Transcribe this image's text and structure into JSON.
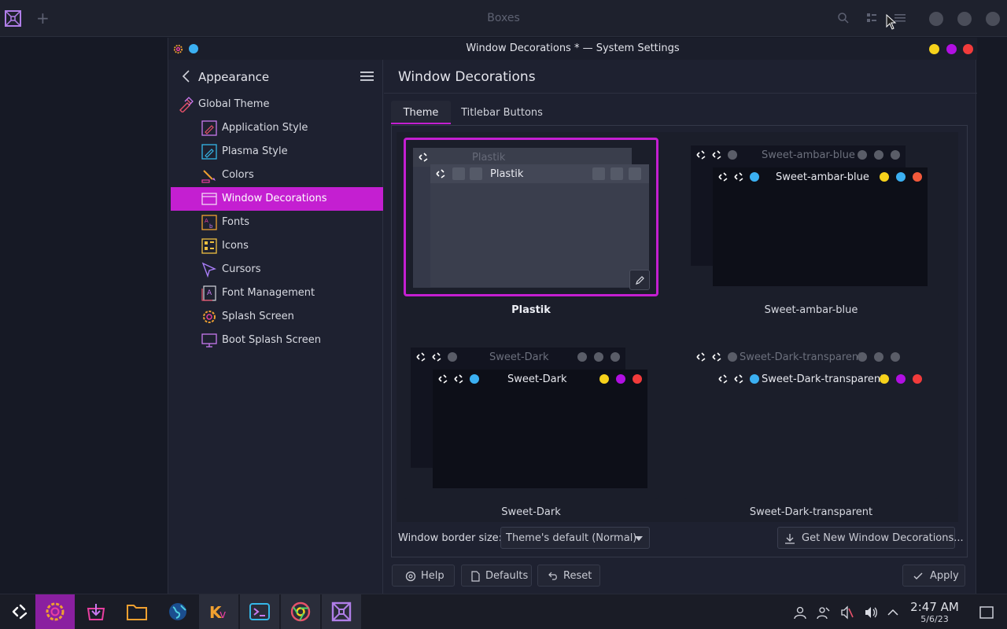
{
  "boxes": {
    "title": "Boxes",
    "add": "+"
  },
  "window": {
    "title": "Window Decorations * — System Settings"
  },
  "sidebar": {
    "header": "Appearance",
    "items": [
      {
        "label": "Global Theme",
        "icon": "global-theme-icon"
      },
      {
        "label": "Application Style",
        "icon": "application-style-icon"
      },
      {
        "label": "Plasma Style",
        "icon": "plasma-style-icon"
      },
      {
        "label": "Colors",
        "icon": "colors-icon"
      },
      {
        "label": "Window Decorations",
        "icon": "window-decorations-icon",
        "active": true
      },
      {
        "label": "Fonts",
        "icon": "fonts-icon"
      },
      {
        "label": "Icons",
        "icon": "icons-icon"
      },
      {
        "label": "Cursors",
        "icon": "cursors-icon"
      },
      {
        "label": "Font Management",
        "icon": "font-management-icon"
      },
      {
        "label": "Splash Screen",
        "icon": "splash-screen-icon"
      },
      {
        "label": "Boot Splash Screen",
        "icon": "boot-splash-screen-icon"
      }
    ]
  },
  "main": {
    "title": "Window Decorations",
    "tabs": [
      {
        "label": "Theme",
        "active": true
      },
      {
        "label": "Titlebar Buttons"
      }
    ],
    "decorations": [
      {
        "name": "Plastik",
        "preview_title": "Plastik",
        "selected": true
      },
      {
        "name": "Sweet-ambar-blue",
        "preview_title": "Sweet-ambar-blue"
      },
      {
        "name": "Sweet-Dark",
        "preview_title": "Sweet-Dark"
      },
      {
        "name": "Sweet-Dark-transparent",
        "preview_title": "Sweet-Dark-transparent"
      }
    ],
    "border_size_label": "Window border size:",
    "border_size_value": "Theme's default (Normal)",
    "get_new_label": "Get New Window Decorations...",
    "buttons": {
      "help": "Help",
      "defaults": "Defaults",
      "reset": "Reset",
      "apply": "Apply"
    }
  },
  "taskbar": {
    "time": "2:47 AM",
    "date": "5/6/23"
  },
  "colors": {
    "accent": "#c41fd1",
    "yellow": "#f7d21b",
    "purple": "#b10fe2",
    "red": "#f23b3b",
    "blue": "#3bb0f2"
  }
}
